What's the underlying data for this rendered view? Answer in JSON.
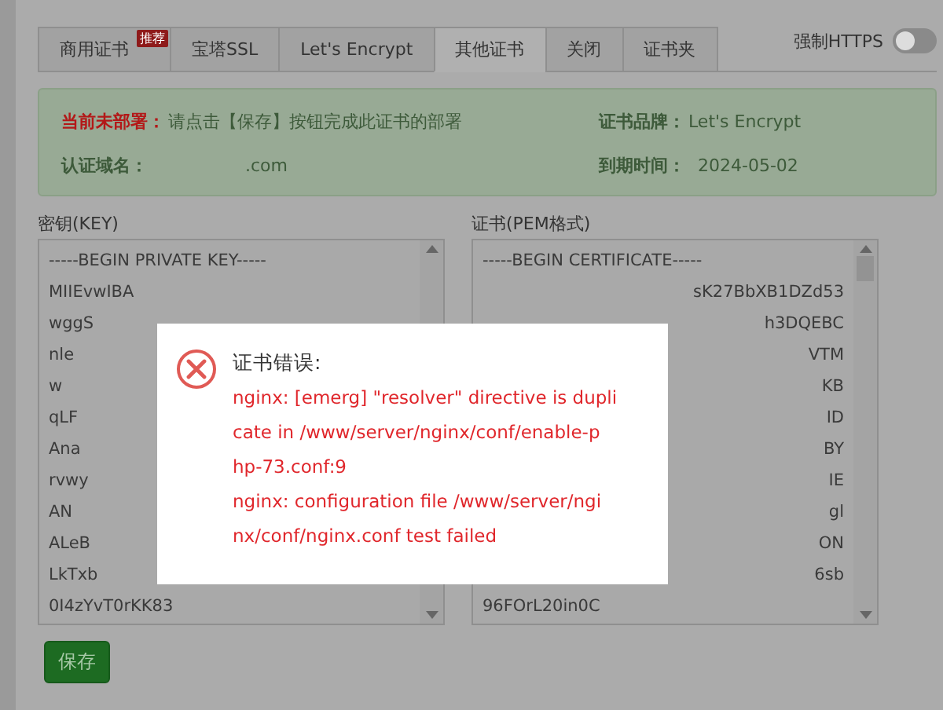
{
  "tabs": [
    {
      "label": "商用证书",
      "selected": false,
      "badge": "推荐"
    },
    {
      "label": "宝塔SSL",
      "selected": false
    },
    {
      "label": "Let's Encrypt",
      "selected": false
    },
    {
      "label": "其他证书",
      "selected": true
    },
    {
      "label": "关闭",
      "selected": false
    },
    {
      "label": "证书夹",
      "selected": false
    }
  ],
  "force_https": {
    "label": "强制HTTPS",
    "on": false
  },
  "info": {
    "status_label": "当前未部署：",
    "status_text": "请点击【保存】按钮完成此证书的部署",
    "domain_label": "认证域名：",
    "domain_value": ".com",
    "brand_label": "证书品牌：",
    "brand_value": "Let's Encrypt",
    "expiry_label": "到期时间：",
    "expiry_value": "2024-05-02"
  },
  "key_box": {
    "label": "密钥(KEY)",
    "lines": [
      {
        "kind": "full",
        "text": "-----BEGIN PRIVATE KEY-----"
      },
      {
        "kind": "full",
        "text": "MIIEvwIBA"
      },
      {
        "kind": "full",
        "text": "wggS"
      },
      {
        "kind": "full",
        "text": "nle"
      },
      {
        "kind": "full",
        "text": "w"
      },
      {
        "kind": "full",
        "text": "qLF"
      },
      {
        "kind": "full",
        "text": "Ana"
      },
      {
        "kind": "full",
        "text": "rvwy"
      },
      {
        "kind": "full",
        "text": "AN"
      },
      {
        "kind": "full",
        "text": "ALeB"
      },
      {
        "kind": "full",
        "text": "LkTxb"
      },
      {
        "kind": "full",
        "text": "0I4zYvT0rKK83"
      }
    ]
  },
  "cert_box": {
    "label": "证书(PEM格式)",
    "lines": [
      {
        "kind": "full",
        "text": "-----BEGIN CERTIFICATE-----"
      },
      {
        "kind": "tail",
        "text": "sK27BbXB1DZd53"
      },
      {
        "kind": "tail",
        "text": "h3DQEBC"
      },
      {
        "kind": "tail",
        "text": "VTM"
      },
      {
        "kind": "tail",
        "text": "KB"
      },
      {
        "kind": "tail",
        "text": "ID"
      },
      {
        "kind": "tail",
        "text": "BY"
      },
      {
        "kind": "tail",
        "text": "IE"
      },
      {
        "kind": "tail",
        "text": "gl"
      },
      {
        "kind": "tail",
        "text": "ON"
      },
      {
        "kind": "tail",
        "text": "6sb"
      },
      {
        "kind": "full",
        "text": "96FOrL20in0C"
      }
    ]
  },
  "save_button": "保存",
  "dialog": {
    "title": "证书错误:",
    "lines": [
      "nginx: [emerg] \"resolver\" directive is dupli",
      "cate in /www/server/nginx/conf/enable-p",
      "hp-73.conf:9",
      "nginx: configuration file /www/server/ngi",
      "nx/conf/nginx.conf test failed"
    ]
  }
}
